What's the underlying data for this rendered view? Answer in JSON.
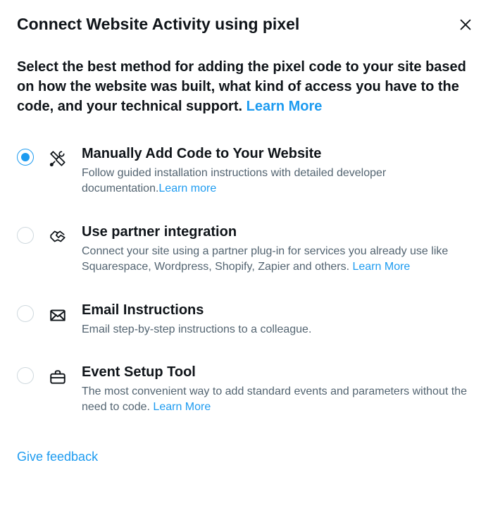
{
  "header": {
    "title": "Connect Website Activity using pixel"
  },
  "intro": {
    "text": "Select the best method for adding the pixel code to your site based on how the website was built, what kind of access you have to the code, and your technical support. ",
    "learn_more": "Learn More"
  },
  "options": [
    {
      "selected": true,
      "icon": "tools-icon",
      "title": "Manually Add Code to Your Website",
      "desc": "Follow guided installation instructions with detailed developer documentation.",
      "learn_more": "Learn more"
    },
    {
      "selected": false,
      "icon": "handshake-icon",
      "title": "Use partner integration",
      "desc": "Connect your site using a partner plug-in for services you already use like Squarespace, Wordpress, Shopify, Zapier and others. ",
      "learn_more": "Learn More"
    },
    {
      "selected": false,
      "icon": "email-icon",
      "title": "Email Instructions",
      "desc": "Email step-by-step instructions to a colleague.",
      "learn_more": ""
    },
    {
      "selected": false,
      "icon": "briefcase-icon",
      "title": "Event Setup Tool",
      "desc": "The most convenient way to add standard events and parameters without the need to code. ",
      "learn_more": "Learn More"
    }
  ],
  "feedback": "Give feedback"
}
